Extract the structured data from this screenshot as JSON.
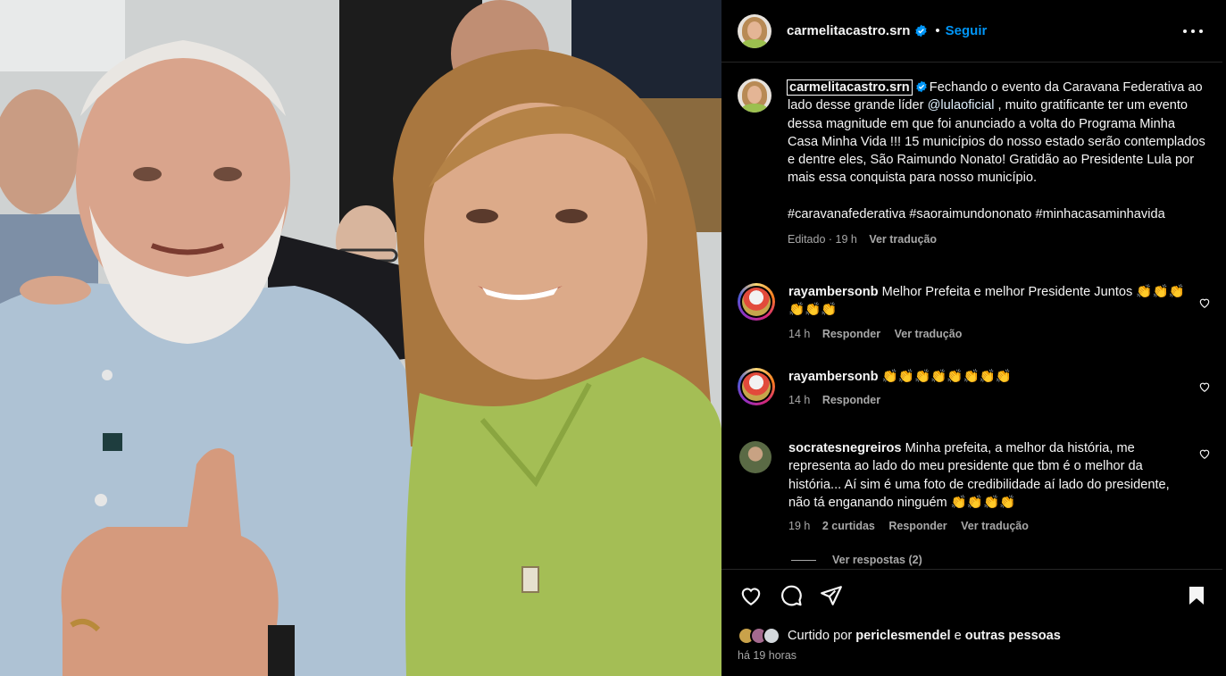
{
  "post": {
    "author": "carmelitacastro.srn",
    "dot": "•",
    "follow_label": "Seguir",
    "caption_username": "carmelitacastro.srn",
    "caption_text": " Fechando o evento da Caravana Federativa ao lado desse grande líder ",
    "caption_mention": "@lulaoficial",
    "caption_text_2": " , muito gratificante ter um evento dessa magnitude em que foi anunciado a volta do Programa Minha Casa Minha Vida !!! 15 municípios do nosso estado serão contemplados e dentre eles, São Raimundo Nonato! Gratidão ao Presidente Lula por mais essa conquista para nosso município.",
    "hashtags": "#caravanafederativa #saoraimundononato #minhacasaminhavida",
    "caption_meta": {
      "edited": "Editado · 19 h",
      "translate": "Ver tradução"
    }
  },
  "comments": [
    {
      "username": "rayambersonb",
      "text": "Melhor Prefeita e melhor Presidente Juntos 👏👏👏👏👏👏",
      "time": "14 h",
      "reply": "Responder",
      "translate": "Ver tradução"
    },
    {
      "username": "rayambersonb",
      "text": "👏👏👏👏👏👏👏👏",
      "time": "14 h",
      "reply": "Responder"
    },
    {
      "username": "socratesnegreiros",
      "text": "Minha prefeita, a melhor da história, me representa ao lado do meu presidente que tbm é o melhor da história... Aí sim é uma foto de credibilidade aí lado do presidente, não tá enganando ninguém 👏👏👏👏",
      "time": "19 h",
      "likes": "2 curtidas",
      "reply": "Responder",
      "translate": "Ver tradução"
    }
  ],
  "view_replies": "Ver respostas (2)",
  "footer": {
    "liked_prefix": "Curtido por",
    "liked_user": "periclesmendel",
    "liked_and": "e",
    "liked_others": "outras pessoas",
    "posted_time": "há 19 horas"
  },
  "icons": {
    "like": "heart-icon",
    "comment": "comment-icon",
    "share": "share-icon",
    "save": "bookmark-icon",
    "more": "more-icon",
    "verified": "verified-badge-icon"
  },
  "colors": {
    "background": "#000000",
    "link_blue": "#0095f6",
    "secondary_text": "#a8a8a8",
    "divider": "#262626",
    "mention": "#e0f1ff"
  }
}
